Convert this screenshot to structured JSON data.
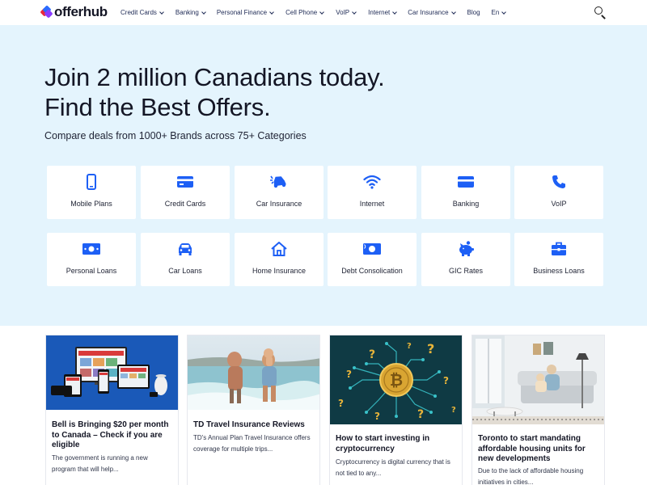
{
  "brand": {
    "name": "offerhub"
  },
  "nav": {
    "items": [
      {
        "label": "Credit Cards",
        "dropdown": true
      },
      {
        "label": "Banking",
        "dropdown": true
      },
      {
        "label": "Personal Finance",
        "dropdown": true
      },
      {
        "label": "Cell Phone",
        "dropdown": true
      },
      {
        "label": "VoIP",
        "dropdown": true
      },
      {
        "label": "Internet",
        "dropdown": true
      },
      {
        "label": "Car Insurance",
        "dropdown": true
      },
      {
        "label": "Blog",
        "dropdown": false
      },
      {
        "label": "En",
        "dropdown": true
      }
    ],
    "search_icon": "search-icon"
  },
  "hero": {
    "headline_line1": "Join 2 million Canadians today.",
    "headline_line2": "Find the Best Offers.",
    "subheadline": "Compare deals from 1000+ Brands across 75+ Categories"
  },
  "categories": [
    {
      "label": "Mobile Plans",
      "icon": "mobile-phone-icon"
    },
    {
      "label": "Credit Cards",
      "icon": "credit-card-icon"
    },
    {
      "label": "Car Insurance",
      "icon": "car-crash-icon"
    },
    {
      "label": "Internet",
      "icon": "wifi-icon"
    },
    {
      "label": "Banking",
      "icon": "bank-card-icon"
    },
    {
      "label": "VoIP",
      "icon": "phone-handset-icon"
    },
    {
      "label": "Personal Loans",
      "icon": "money-bill-icon"
    },
    {
      "label": "Car Loans",
      "icon": "car-icon"
    },
    {
      "label": "Home Insurance",
      "icon": "home-icon"
    },
    {
      "label": "Debt Consolication",
      "icon": "cash-icon"
    },
    {
      "label": "GIC Rates",
      "icon": "piggy-bank-icon"
    },
    {
      "label": "Business Loans",
      "icon": "briefcase-icon"
    }
  ],
  "articles": [
    {
      "title": "Bell is Bringing $20 per month to Canada – Check if you are eligible",
      "excerpt": "The government is running a new program that will help...",
      "image": "devices-on-blue-image"
    },
    {
      "title": "TD Travel Insurance Reviews",
      "excerpt": "TD's Annual Plan Travel Insurance offers coverage for multiple trips...",
      "image": "beach-family-image"
    },
    {
      "title": "How to start investing in cryptocurrency",
      "excerpt": "Cryptocurrency is digital currency that is not tied to any...",
      "image": "bitcoin-circuit-image"
    },
    {
      "title": "Toronto to start mandating affordable housing units for new developments",
      "excerpt": "Due to the lack of affordable housing initiatives in cities...",
      "image": "living-room-image"
    }
  ],
  "colors": {
    "accent": "#1d5ff5",
    "hero_bg": "#e4f4fd",
    "text_dark": "#141625",
    "nav_text": "#1e2a55",
    "card_bg": "#ffffff"
  }
}
